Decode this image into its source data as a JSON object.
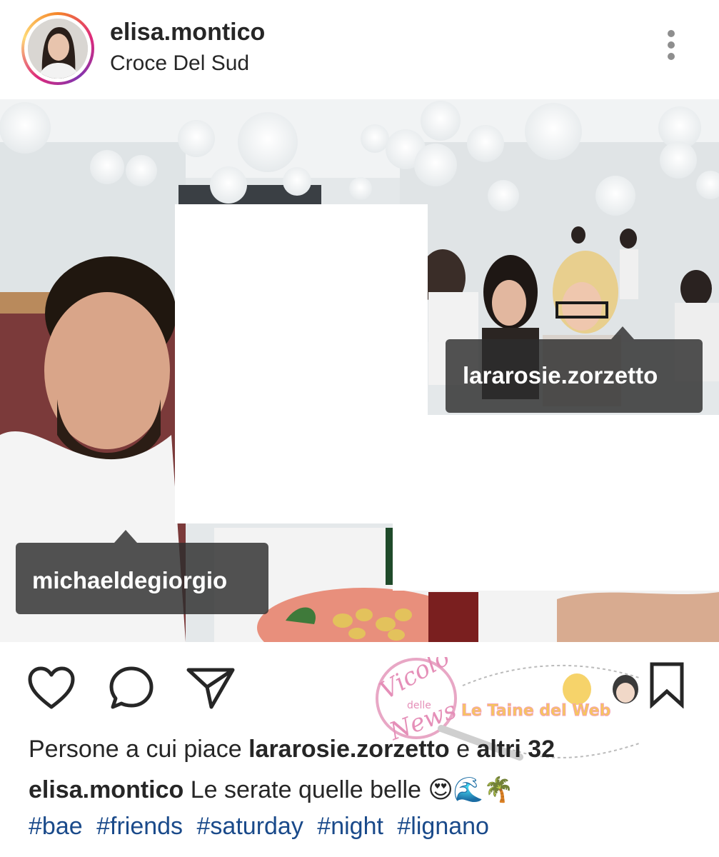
{
  "header": {
    "username": "elisa.montico",
    "location": "Croce Del Sud"
  },
  "post": {
    "tags": [
      {
        "label": "lararosie.zorzetto"
      },
      {
        "label": "michaeldegiorgio"
      }
    ]
  },
  "actions": {
    "icons": [
      "heart-icon",
      "comment-icon",
      "share-icon",
      "bookmark-icon"
    ]
  },
  "watermark": {
    "line1": "Vicolo",
    "line2": "delle",
    "line3": "News",
    "banner": "Le Taine del Web"
  },
  "likes": {
    "prefix": "Persone a cui piace",
    "user": "lararosie.zorzetto",
    "conj": "e",
    "others": "altri 32"
  },
  "caption": {
    "username": "elisa.montico",
    "text": "Le serate quelle belle",
    "emojis": "😍🌊🌴"
  },
  "hashtags": [
    "#bae",
    "#friends",
    "#saturday",
    "#night",
    "#lignano"
  ],
  "colors": {
    "text": "#262626",
    "hashtag": "#1a4a8a",
    "icon_gray": "#8e8e8e"
  }
}
